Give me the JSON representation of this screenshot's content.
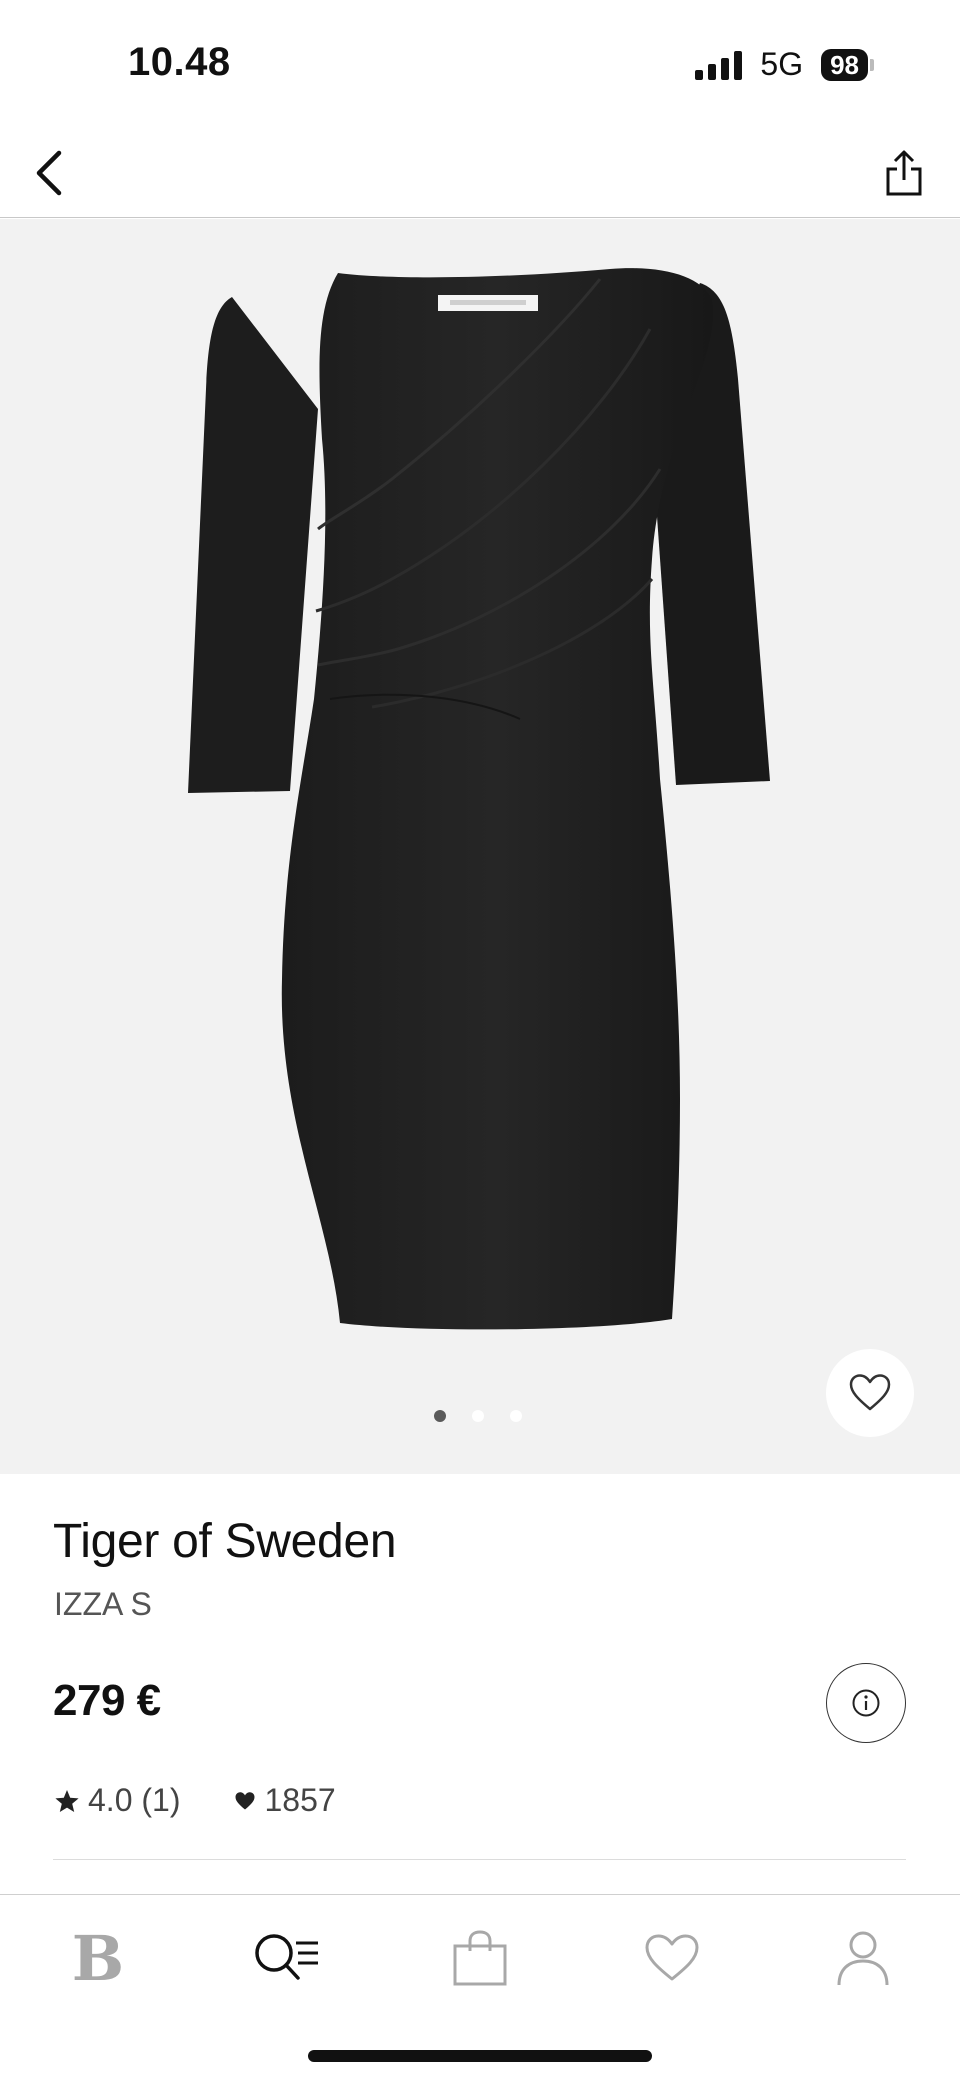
{
  "status_bar": {
    "time": "10.48",
    "network": "5G",
    "battery": "98"
  },
  "nav": {
    "back_icon": "chevron-left-icon",
    "share_icon": "share-icon"
  },
  "gallery": {
    "image": "black three-quarter-sleeve draped dress",
    "image_count": 3,
    "active_index": 0,
    "favorite_icon": "heart-outline-icon"
  },
  "product": {
    "brand": "Tiger of Sweden",
    "name": "IZZA S",
    "price": "279 €",
    "rating": "4.0 (1)",
    "likes": "1857"
  },
  "tab_bar": {
    "items": [
      {
        "id": "home",
        "icon": "brand-logo",
        "label": "B"
      },
      {
        "id": "search",
        "icon": "search-list-icon"
      },
      {
        "id": "bag",
        "icon": "shopping-bag-icon"
      },
      {
        "id": "wishlist",
        "icon": "heart-icon"
      },
      {
        "id": "account",
        "icon": "person-icon"
      }
    ]
  },
  "colors": {
    "background": "#ffffff",
    "gallery_bg": "#f2f2f2",
    "text": "#111111",
    "muted": "#555555",
    "tab_icon": "#a8a8a8"
  }
}
